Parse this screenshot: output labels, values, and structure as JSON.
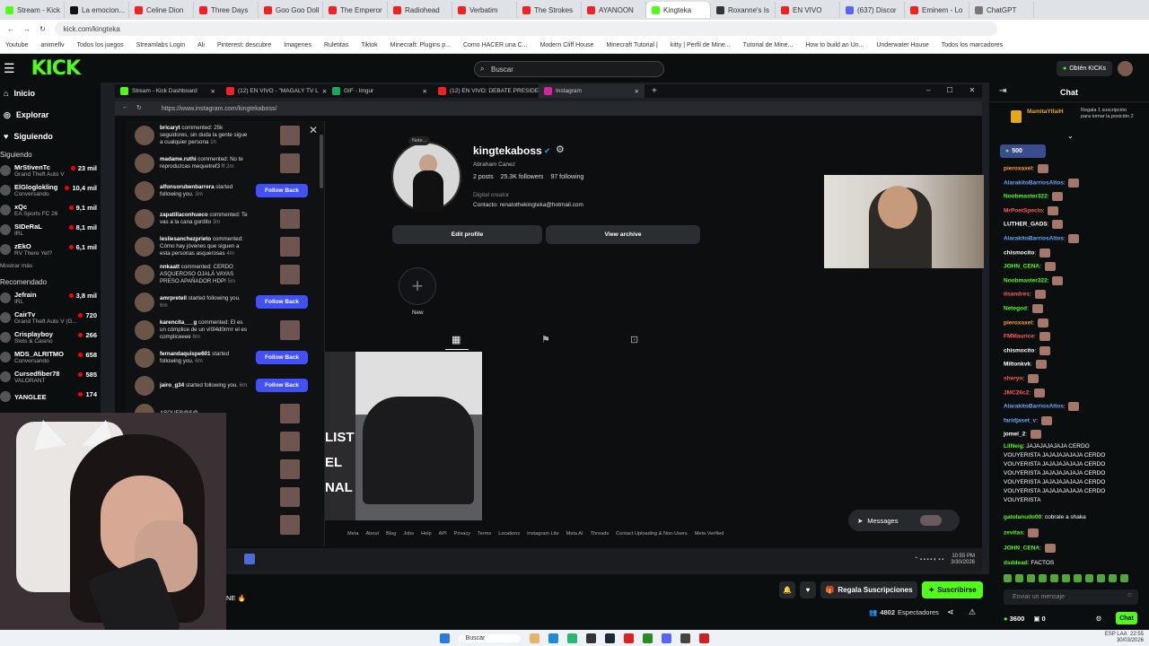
{
  "browser": {
    "tabs": [
      "Stream - Kick",
      "La emocion...",
      "Celine Dion",
      "Three Days",
      "Goo Goo Doll",
      "The Emperor",
      "Radiohead",
      "Verbatim",
      "The Strokes",
      "AYANOON",
      "Kingteka",
      "Roxanne's Is",
      "EN VIVO",
      "(637) Discor",
      "Eminem - Lo",
      "ChatGPT"
    ],
    "url": "kick.com/kingteka",
    "bookmarks": [
      "Youtube",
      "animeflv",
      "Todos los juegos",
      "Streamlabs Login",
      "Ali",
      "Pinterest: descubre",
      "Imagenes",
      "Ruletitas",
      "Tiktok",
      "Minecraft: Plugins p...",
      "Como HACER una C...",
      "Modern Cliff House",
      "Minecraft Tutorial |",
      "kitty | Perfil de Mine...",
      "Tutorial de Mine...",
      "How to build an Un...",
      "Underwater House",
      "Todos los marcadores"
    ]
  },
  "kick": {
    "logo": "KICK",
    "search_placeholder": "Buscar",
    "kicks_button": "Obtén KICKs"
  },
  "sidebar": {
    "nav": [
      "Inicio",
      "Explorar",
      "Siguiendo"
    ],
    "following_title": "Siguiendo",
    "following": [
      {
        "name": "MrStivenTc",
        "game": "Grand Theft Auto V",
        "viewers": "23 mil"
      },
      {
        "name": "ElGloglokling",
        "game": "Conversando",
        "viewers": "10,4 mil"
      },
      {
        "name": "xQc",
        "game": "EA Sports FC 26",
        "viewers": "9,1 mil"
      },
      {
        "name": "SIDeRaL",
        "game": "IRL",
        "viewers": "8,1 mil"
      },
      {
        "name": "zEkO",
        "game": "RV There Yet?",
        "viewers": "6,1 mil"
      }
    ],
    "show_more": "Mostrar más",
    "recommended_title": "Recomendado",
    "recommended": [
      {
        "name": "Jefrain",
        "game": "IRL",
        "viewers": "3,8 mil"
      },
      {
        "name": "CairTv",
        "game": "Grand Theft Auto V (G...",
        "viewers": "720"
      },
      {
        "name": "Crisplayboy",
        "game": "Slots & Casino",
        "viewers": "266"
      },
      {
        "name": "MDS_ALRITMO",
        "game": "Conversando",
        "viewers": "658"
      },
      {
        "name": "Cursedfiber78",
        "game": "VALORANT",
        "viewers": "585"
      },
      {
        "name": "YANGLEE",
        "game": "",
        "viewers": "174"
      }
    ]
  },
  "inner_browser": {
    "tabs": [
      "Stream - Kick Dashboard",
      "(12) EN VIVO - \"MAGALY TV L",
      "GIF - Imgur",
      "(12) EN VIVO: DEBATE PRESIDENC",
      "Instagram"
    ],
    "url": "https://www.instagram.com/kingtekaboss/"
  },
  "notifications": [
    {
      "user": "bricaryt",
      "text": " commented: 25k seguidores, sin duda la gente sigue a cualquier persona",
      "time": "1h",
      "follow": false
    },
    {
      "user": "madame.ruthi",
      "text": " commented: No te reproduzcas mequetref3 !! ",
      "time": "2m",
      "follow": false
    },
    {
      "user": "alfonsorubenbarrera",
      "text": " started following you.",
      "time": "3m",
      "follow": true
    },
    {
      "user": "zapatillaconhueco",
      "text": " commented: Te vas a la cana gordito",
      "time": "3m",
      "follow": false
    },
    {
      "user": "lesliesanchezprieto",
      "text": " commented: Cómo hay jóvenes que siguen a esta personas asquerosas",
      "time": "4m",
      "follow": false
    },
    {
      "user": "nnkaatt",
      "text": " commented: CERDO ASQUEROSO OJALÁ VAYAS PRESO APAÑADOR HDP!",
      "time": "5m",
      "follow": false
    },
    {
      "user": "amrpretell",
      "text": " started following you.",
      "time": "6m",
      "follow": true
    },
    {
      "user": "karencita___g",
      "text": " commented: El es un cómplice de un v!0l4d0rrrrr el es compliceeee",
      "time": "6m",
      "follow": false
    },
    {
      "user": "fernandaquispe601",
      "text": " started following you.",
      "time": "6m",
      "follow": true
    },
    {
      "user": "jairo_g34",
      "text": " started following you.",
      "time": "6m",
      "follow": true
    }
  ],
  "notification_partials": [
    "ASQUER@S@",
    "APAÑADOR",
    "violadores 7m",
    "Que asco 7m",
    "Asqueroso en la cárcel 7m"
  ],
  "follow_back_label": "Follow Back",
  "profile": {
    "note": "Note...",
    "username": "kingtekaboss",
    "full_name": "Abraham Canez",
    "posts": "2 posts",
    "followers": "25.3K followers",
    "following": "97 following",
    "category": "Digital creator",
    "contact": "Contacto: renatothekingteka@hotmail.com",
    "edit_profile": "Edit profile",
    "view_archive": "View archive",
    "new_highlight": "New",
    "banner_text": "LIST EL NAL"
  },
  "ig_footer": [
    "Meta",
    "About",
    "Blog",
    "Jobs",
    "Help",
    "API",
    "Privacy",
    "Terms",
    "Locations",
    "Instagram Lite",
    "Meta AI",
    "Threads",
    "Contact Uploading & Non-Users",
    "Meta Verified"
  ],
  "messages_label": "Messages",
  "inner_clock": {
    "time": "10:55 PM",
    "date": "3/30/2026"
  },
  "stream_bottom": {
    "title_fragment": "NE 🔥",
    "gift_subs": "Regala Suscripciones",
    "subscribe": "Suscribirse",
    "viewers_count": "4802",
    "viewers_label": "Espectadores"
  },
  "chat": {
    "title": "Chat",
    "pinned_user": "MamitaYifaiH",
    "pinned_text": "Regala 1 suscripción para tomar la posición 2",
    "sub_badge": "500",
    "messages": [
      {
        "user": "pieroxaxel",
        "text": "",
        "color": "o"
      },
      {
        "user": "AlarakitoBarriosAltos",
        "text": "",
        "color": "b"
      },
      {
        "user": "Noobmaster322",
        "text": "",
        "color": "g"
      },
      {
        "user": "MrPoetSpecto",
        "text": "",
        "color": "r"
      },
      {
        "user": "LUTHER_GADS",
        "text": "",
        "color": "w"
      },
      {
        "user": "AlarakitoBarriosAltos",
        "text": "",
        "color": "b"
      },
      {
        "user": "chismocito",
        "text": "",
        "color": "w"
      },
      {
        "user": "JOHN_CENA",
        "text": "",
        "color": "g"
      },
      {
        "user": "Noobmaster322",
        "text": "",
        "color": "g"
      },
      {
        "user": "dsandres",
        "text": "",
        "color": "r"
      },
      {
        "user": "Netegod",
        "text": "",
        "color": "g"
      },
      {
        "user": "pieroxaxel",
        "text": "",
        "color": "o"
      },
      {
        "user": "FMMaurice",
        "text": "",
        "color": "r"
      },
      {
        "user": "chismocito",
        "text": "",
        "color": "w"
      },
      {
        "user": "Miltonkvk",
        "text": "",
        "color": "w"
      },
      {
        "user": "sheryn",
        "text": "",
        "color": "r"
      },
      {
        "user": "JMC26c2",
        "text": "",
        "color": "r"
      },
      {
        "user": "AlarakitoBarriosAltos",
        "text": "",
        "color": "b"
      },
      {
        "user": "faridjaset_v",
        "text": "",
        "color": "b"
      },
      {
        "user": "jomel_2",
        "text": "",
        "color": "w"
      }
    ],
    "long_msg_user": "LilNeig",
    "long_msg_lines": [
      "JAJAJAJAJAJA CERDO",
      "VOUYERISTA JAJAJAJAJAJA CERDO",
      "VOUYERISTA JAJAJAJAJAJA CERDO",
      "VOUYERISTA JAJAJAJAJAJA CERDO",
      "VOUYERISTA JAJAJAJAJAJA CERDO",
      "VOUYERISTA JAJAJAJAJAJA CERDO",
      "VOUYERISTA"
    ],
    "tail_messages": [
      {
        "user": "gatolanudo00",
        "text": "cobrale a shaka"
      },
      {
        "user": "zevitas",
        "text": ""
      },
      {
        "user": "JOHN_CENA",
        "text": ""
      },
      {
        "user": "dsddead",
        "text": "FACTOS"
      }
    ],
    "input_placeholder": "Enviar un mensaje",
    "points": "3600",
    "other": "0",
    "send_label": "Chat"
  },
  "windows": {
    "search": "Buscar",
    "lang": "ESP LAA",
    "time": "22:55",
    "date": "30/03/2026"
  }
}
